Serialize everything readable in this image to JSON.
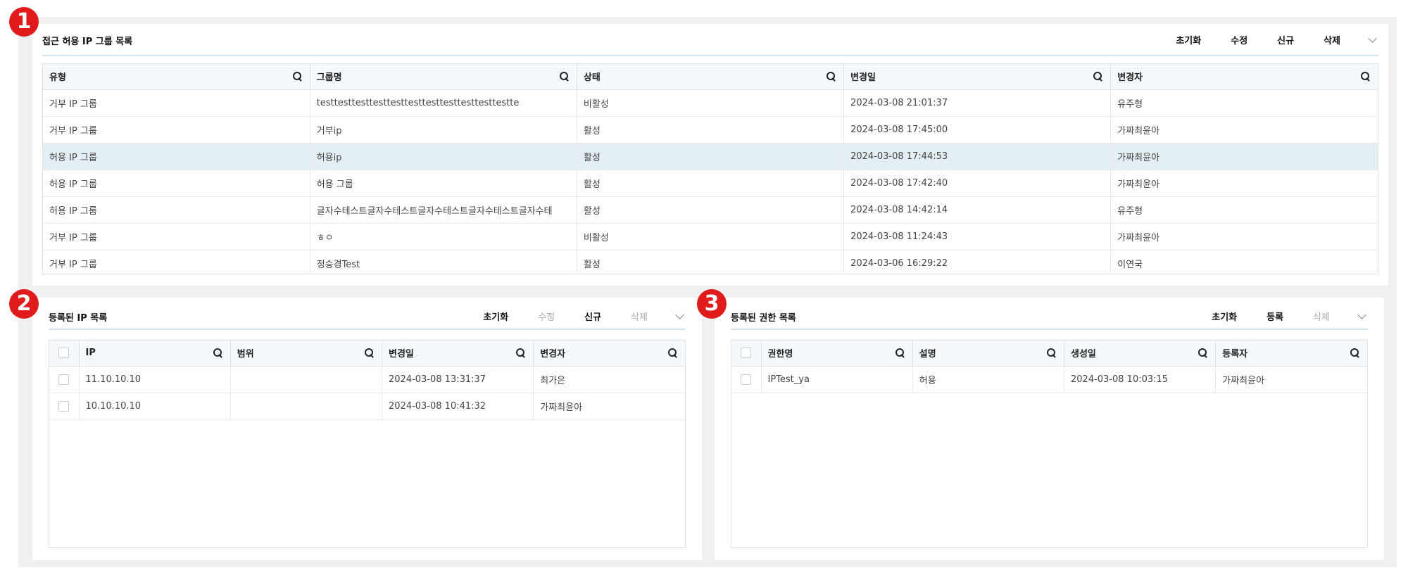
{
  "badges": [
    "1",
    "2",
    "3"
  ],
  "group_panel": {
    "title": "접근 허용 IP 그룹 목록",
    "actions": {
      "reset": "초기화",
      "edit": "수정",
      "new": "신규",
      "delete": "삭제"
    },
    "columns": [
      "유형",
      "그룹명",
      "상태",
      "변경일",
      "변경자"
    ],
    "rows": [
      [
        "거부 IP 그룹",
        "testtesttesttesttesttesttesttesttesttesttestte",
        "비활성",
        "2024-03-08 21:01:37",
        "유주형"
      ],
      [
        "거부 IP 그룹",
        "거부ip",
        "활성",
        "2024-03-08 17:45:00",
        "가짜최윤아"
      ],
      [
        "허용 IP 그룹",
        "허용ip",
        "활성",
        "2024-03-08 17:44:53",
        "가짜최윤아"
      ],
      [
        "허용 IP 그룹",
        "허용 그룹",
        "활성",
        "2024-03-08 17:42:40",
        "가짜최윤아"
      ],
      [
        "허용 IP 그룹",
        "글자수테스트글자수테스트글자수테스트글자수테스트글자수테",
        "활성",
        "2024-03-08 14:42:14",
        "유주형"
      ],
      [
        "거부 IP 그룹",
        "ㅎㅇ",
        "비활성",
        "2024-03-08 11:24:43",
        "가짜최윤아"
      ],
      [
        "거부 IP 그룹",
        "정승경Test",
        "활성",
        "2024-03-06 16:29:22",
        "이연국"
      ]
    ],
    "selected_row": 2
  },
  "ip_panel": {
    "title": "등록된 IP 목록",
    "actions": {
      "reset": "초기화",
      "edit": "수정",
      "new": "신규",
      "delete": "삭제"
    },
    "columns": [
      "IP",
      "범위",
      "변경일",
      "변경자"
    ],
    "rows": [
      [
        "11.10.10.10",
        "",
        "2024-03-08 13:31:37",
        "최가은"
      ],
      [
        "10.10.10.10",
        "",
        "2024-03-08 10:41:32",
        "가짜최윤아"
      ]
    ]
  },
  "perm_panel": {
    "title": "등록된 권한 목록",
    "actions": {
      "reset": "초기화",
      "register": "등록",
      "delete": "삭제"
    },
    "columns": [
      "권한명",
      "설명",
      "생성일",
      "등록자"
    ],
    "rows": [
      [
        "IPTest_ya",
        "허용",
        "2024-03-08 10:03:15",
        "가짜최윤아"
      ]
    ]
  },
  "colors": {
    "accent_line": "#d6e4ee",
    "selected_row": "#e4eff4",
    "badge": "#e11b1b",
    "background": "#eef0f1"
  },
  "icons": [
    "search-icon",
    "chevron-down-icon",
    "checkbox"
  ]
}
